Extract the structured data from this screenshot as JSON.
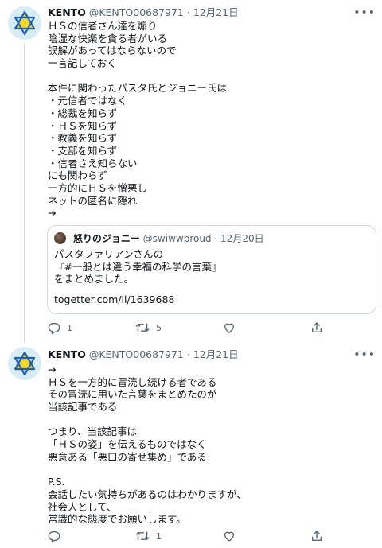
{
  "tweets": [
    {
      "author_name": "KENTO",
      "author_handle": "@KENTO00687971",
      "separator": "·",
      "date": "12月21日",
      "more": "•••",
      "lines": [
        "ＨＳの信者さん達を煽り",
        "陰湿な快楽を貪る者がいる",
        "誤解があってはならないので",
        "一言記しておく",
        "",
        "本件に関わったパスタ氏とジョニー氏は",
        "・元信者ではなく",
        "・総裁を知らず",
        "・ＨＳを知らず",
        "・教義を知らず",
        "・支部を知らず",
        "・信者さえ知らない",
        "にも関わらず",
        "一方的にＨＳを憎悪し",
        "ネットの匿名に隠れ",
        "→"
      ],
      "quote": {
        "author_name": "怒りのジョニー",
        "author_handle": "@swiwwproud",
        "separator": "·",
        "date": "12月20日",
        "lines": [
          "パスタファリアンさんの",
          "『#一般とは違う幸福の科学の言葉』",
          "をまとめました。"
        ],
        "link": "togetter.com/li/1639688"
      },
      "reply_count": "1",
      "retweet_count": "5",
      "like_count": "",
      "share_count": ""
    },
    {
      "author_name": "KENTO",
      "author_handle": "@KENTO00687971",
      "separator": "·",
      "date": "12月21日",
      "more": "•••",
      "lines": [
        "→",
        "ＨＳを一方的に冒涜し続ける者である",
        "その冒涜に用いた言葉をまとめたのが",
        "当該記事である",
        "",
        "つまり、当該記事は",
        "「ＨＳの姿」を伝えるものではなく",
        "悪意ある「悪口の寄せ集め」である",
        "",
        "P.S.",
        "会話したい気持ちがあるのはわかりますが、",
        "社会人として、",
        "常識的な態度でお願いします。"
      ],
      "reply_count": "",
      "retweet_count": "1",
      "like_count": "",
      "share_count": ""
    }
  ],
  "colors": {
    "text": "#0f1419",
    "secondary": "#536471",
    "border": "#cfd9de",
    "avatar_bg": "#d8ecf5",
    "star_blue": "#1d5fb8",
    "star_yellow": "#f2d72f"
  },
  "icons": [
    "star-of-david-icon",
    "reply-icon",
    "retweet-icon",
    "like-icon",
    "share-icon",
    "more-icon"
  ]
}
